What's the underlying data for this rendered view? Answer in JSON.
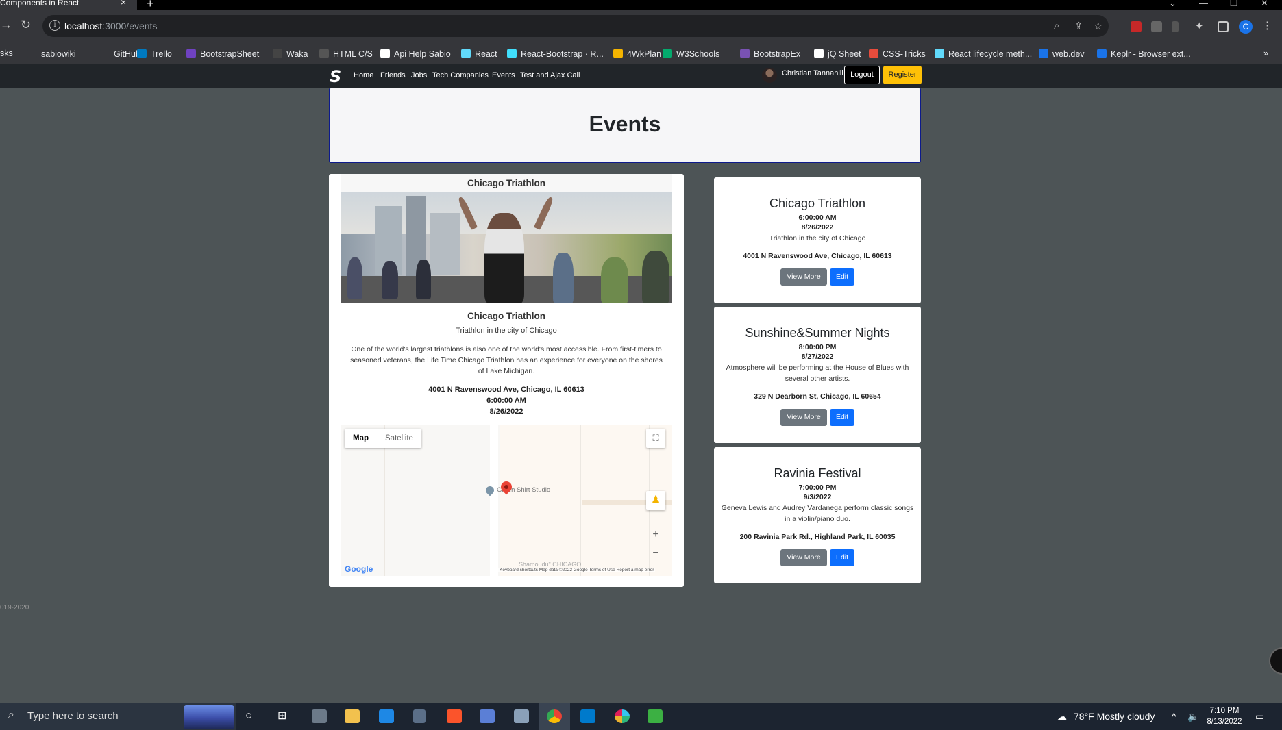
{
  "browser": {
    "tab_title": "Components in React",
    "tab_close": "×",
    "new_tab": "+",
    "url_host": "localhost",
    "url_path": ":3000/events",
    "bookmarks": [
      {
        "label": "sks",
        "color": "#35363a"
      },
      {
        "label": "sabiowiki",
        "color": "#35363a"
      },
      {
        "label": "GitHub",
        "color": "#35363a"
      },
      {
        "label": "Trello",
        "color": "#0079bf"
      },
      {
        "label": "BootstrapSheet",
        "color": "#6f42c1"
      },
      {
        "label": "Waka",
        "color": "#444444"
      },
      {
        "label": "HTML C/S",
        "color": "#555555"
      },
      {
        "label": "Api Help Sabio",
        "color": "#ffffff"
      },
      {
        "label": "React",
        "color": "#61dafb"
      },
      {
        "label": "React-Bootstrap · R...",
        "color": "#41e0fd"
      },
      {
        "label": "4WkPlan",
        "color": "#f4b400"
      },
      {
        "label": "W3Schools",
        "color": "#04aa6d"
      },
      {
        "label": "BootstrapEx",
        "color": "#7952b3"
      },
      {
        "label": "jQ Sheet",
        "color": "#ffffff"
      },
      {
        "label": "CSS-Tricks",
        "color": "#e74c3c"
      },
      {
        "label": "React lifecycle meth...",
        "color": "#61dafb"
      },
      {
        "label": "web.dev",
        "color": "#1a73e8"
      },
      {
        "label": "Keplr - Browser ext...",
        "color": "#1a73e8"
      }
    ],
    "bookmarks_more": "»",
    "profile_initial": "C"
  },
  "app_nav": {
    "brand": "S",
    "links": [
      "Home",
      "Friends",
      "Jobs",
      "Tech Companies",
      "Events",
      "Test and Ajax Call"
    ],
    "user_name": "Christian Tannahill",
    "logout_label": "Logout",
    "register_label": "Register"
  },
  "page": {
    "title": "Events"
  },
  "featured": {
    "header": "Chicago Triathlon",
    "title": "Chicago Triathlon",
    "summary": "Triathlon in the city of Chicago",
    "description": "One of the world's largest triathlons is also one of the world's most accessible. From first-timers to seasoned veterans, the Life Time Chicago Triathlon has an experience for everyone on the shores of Lake Michigan.",
    "address": "4001 N Ravenswood Ave, Chicago, IL 60613",
    "time": "6:00:00 AM",
    "date": "8/26/2022"
  },
  "map": {
    "type_map": "Map",
    "type_satellite": "Satellite",
    "poi_label": "Green Shirt Studio",
    "faint_label": "Shamoudu\" CHICAGO",
    "google": "Google",
    "attribution": "Keyboard shortcuts   Map data ©2022 Google   Terms of Use   Report a map error",
    "zoom_in": "+",
    "zoom_out": "−"
  },
  "events": [
    {
      "title": "Chicago Triathlon",
      "time": "6:00:00 AM",
      "date": "8/26/2022",
      "summary": "Triathlon in the city of Chicago",
      "address": "4001 N Ravenswood Ave, Chicago, IL 60613",
      "view_label": "View More",
      "edit_label": "Edit"
    },
    {
      "title": "Sunshine&Summer Nights",
      "time": "8:00:00 PM",
      "date": "8/27/2022",
      "summary": "Atmosphere will be performing at the House of Blues with several other artists.",
      "address": "329 N Dearborn St, Chicago, IL 60654",
      "view_label": "View More",
      "edit_label": "Edit"
    },
    {
      "title": "Ravinia Festival",
      "time": "7:00:00 PM",
      "date": "9/3/2022",
      "summary": "Geneva Lewis and Audrey Vardanega perform classic songs in a violin/piano duo.",
      "address": "200 Ravinia Park Rd., Highland Park, IL 60035",
      "view_label": "View More",
      "edit_label": "Edit"
    }
  ],
  "footer": "019-2020",
  "taskbar": {
    "search_placeholder": "Type here to search",
    "weather": "78°F  Mostly cloudy",
    "time": "7:10 PM",
    "date": "8/13/2022"
  }
}
